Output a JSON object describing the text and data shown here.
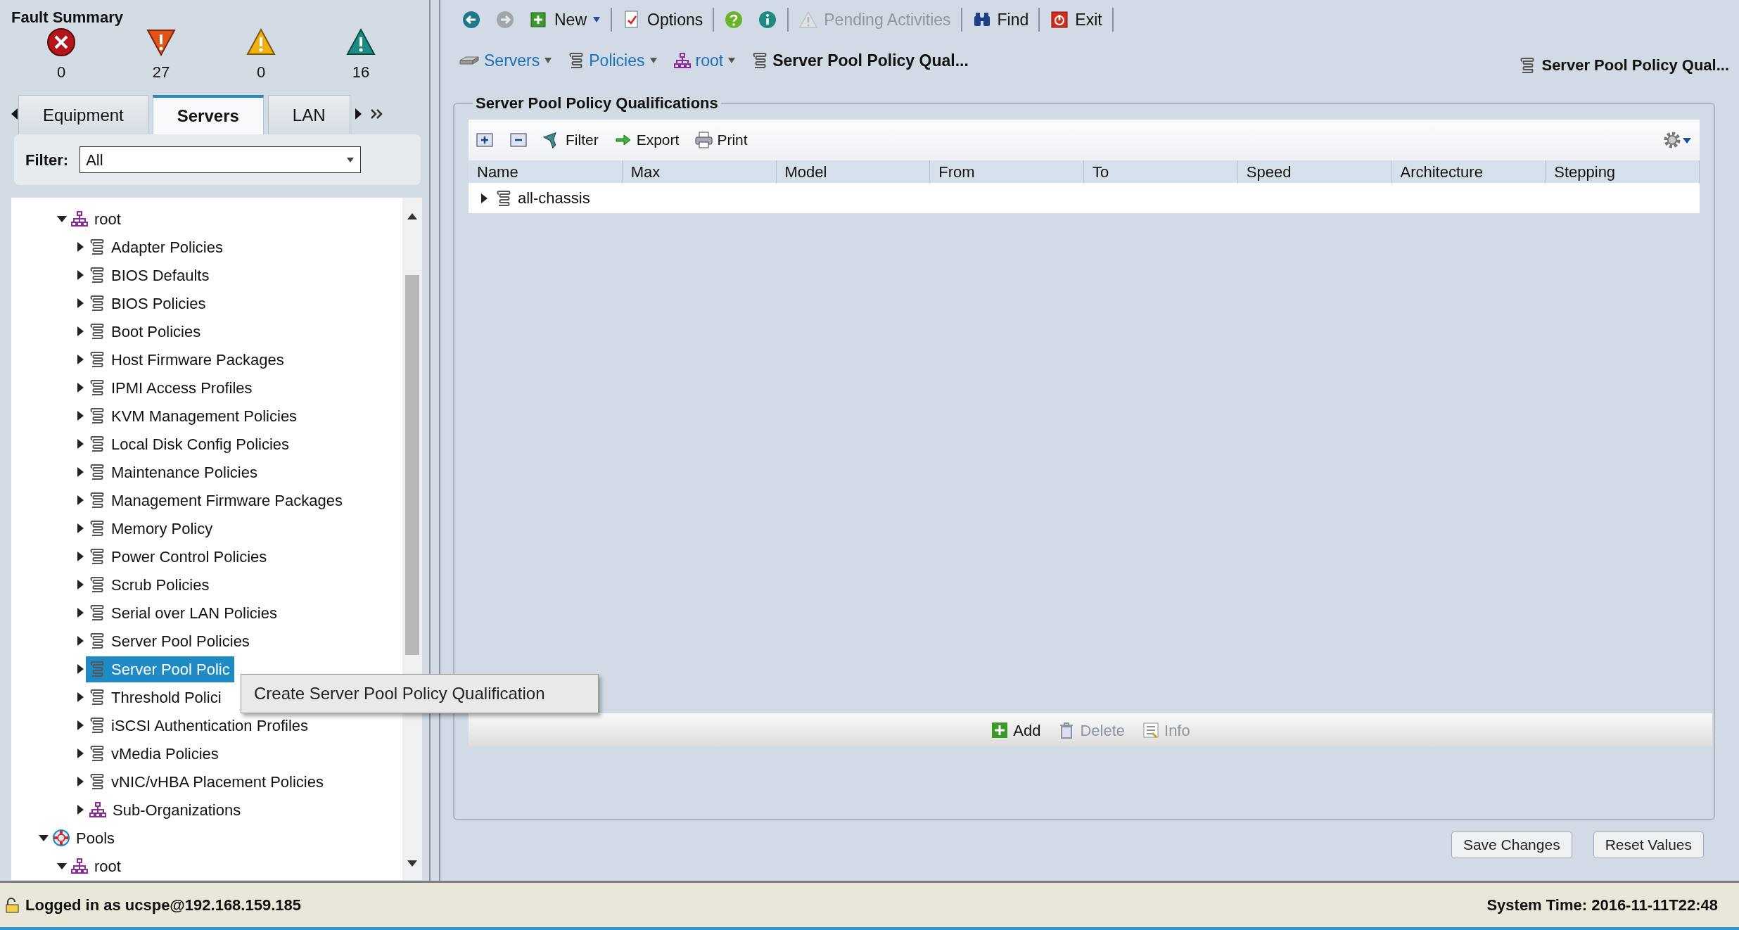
{
  "fault_summary": {
    "title": "Fault Summary",
    "counts": [
      {
        "kind": "critical",
        "count": "0"
      },
      {
        "kind": "major",
        "count": "27"
      },
      {
        "kind": "minor",
        "count": "0"
      },
      {
        "kind": "warning",
        "count": "16"
      }
    ]
  },
  "nav_tabs": [
    {
      "label": "Equipment",
      "selected": false
    },
    {
      "label": "Servers",
      "selected": true
    },
    {
      "label": "LAN",
      "selected": false
    }
  ],
  "filter": {
    "label": "Filter:",
    "value": "All"
  },
  "tree": {
    "partial_branch": [
      {
        "label": "root",
        "kind": "org",
        "expanded": true,
        "selected": false,
        "children": [
          {
            "label": "Adapter Policies",
            "kind": "policy",
            "expanded": false,
            "selected": false
          },
          {
            "label": "BIOS Defaults",
            "kind": "policy",
            "expanded": false,
            "selected": false
          },
          {
            "label": "BIOS Policies",
            "kind": "policy",
            "expanded": false,
            "selected": false
          },
          {
            "label": "Boot Policies",
            "kind": "policy",
            "expanded": false,
            "selected": false
          },
          {
            "label": "Host Firmware Packages",
            "kind": "policy",
            "expanded": false,
            "selected": false
          },
          {
            "label": "IPMI Access Profiles",
            "kind": "policy",
            "expanded": false,
            "selected": false
          },
          {
            "label": "KVM Management Policies",
            "kind": "policy",
            "expanded": false,
            "selected": false
          },
          {
            "label": "Local Disk Config Policies",
            "kind": "policy",
            "expanded": false,
            "selected": false
          },
          {
            "label": "Maintenance Policies",
            "kind": "policy",
            "expanded": false,
            "selected": false
          },
          {
            "label": "Management Firmware Packages",
            "kind": "policy",
            "expanded": false,
            "selected": false
          },
          {
            "label": "Memory Policy",
            "kind": "policy",
            "expanded": false,
            "selected": false
          },
          {
            "label": "Power Control Policies",
            "kind": "policy",
            "expanded": false,
            "selected": false
          },
          {
            "label": "Scrub Policies",
            "kind": "policy",
            "expanded": false,
            "selected": false
          },
          {
            "label": "Serial over LAN Policies",
            "kind": "policy",
            "expanded": false,
            "selected": false
          },
          {
            "label": "Server Pool Policies",
            "kind": "policy",
            "expanded": false,
            "selected": false
          },
          {
            "label": "Server Pool Polic",
            "kind": "policy",
            "expanded": false,
            "selected": true
          },
          {
            "label": "Threshold Polici",
            "kind": "policy",
            "expanded": false,
            "selected": false
          },
          {
            "label": "iSCSI Authentication Profiles",
            "kind": "policy",
            "expanded": false,
            "selected": false
          },
          {
            "label": "vMedia Policies",
            "kind": "policy",
            "expanded": false,
            "selected": false
          },
          {
            "label": "vNIC/vHBA Placement Policies",
            "kind": "policy",
            "expanded": false,
            "selected": false
          },
          {
            "label": "Sub-Organizations",
            "kind": "org",
            "expanded": false,
            "selected": false
          }
        ]
      }
    ],
    "items": [
      {
        "label": "Pools",
        "kind": "pool",
        "expanded": true,
        "selected": false,
        "children": [
          {
            "label": "root",
            "kind": "org",
            "expanded": true,
            "selected": false
          }
        ]
      }
    ]
  },
  "context_menu": {
    "items": [
      "Create Server Pool Policy Qualification"
    ]
  },
  "toolbar": [
    {
      "kind": "back",
      "disabled": false
    },
    {
      "kind": "forward",
      "disabled": true
    },
    {
      "kind": "new",
      "label": "New",
      "disabled": false
    },
    {
      "kind": "options",
      "label": "Options",
      "disabled": false
    },
    {
      "kind": "help",
      "disabled": false
    },
    {
      "kind": "info",
      "disabled": false
    },
    {
      "kind": "pending",
      "label": "Pending Activities",
      "disabled": true
    },
    {
      "kind": "find",
      "label": "Find",
      "disabled": false
    },
    {
      "kind": "exit",
      "label": "Exit",
      "disabled": false
    }
  ],
  "breadcrumb": [
    {
      "kind": "servers",
      "label": "Servers"
    },
    {
      "kind": "policy",
      "label": "Policies"
    },
    {
      "kind": "org",
      "label": "root"
    },
    {
      "kind": "current",
      "label": "Server Pool Policy Qual..."
    }
  ],
  "current_title": "Server Pool Policy Qual...",
  "panel": {
    "title": "Server Pool Policy Qualifications",
    "table_toolbar": [
      {
        "kind": "expand"
      },
      {
        "kind": "collapse"
      },
      {
        "kind": "filter",
        "label": "Filter"
      },
      {
        "kind": "export",
        "label": "Export"
      },
      {
        "kind": "print",
        "label": "Print"
      }
    ],
    "columns": [
      "Name",
      "Max",
      "Model",
      "From",
      "To",
      "Speed",
      "Architecture",
      "Stepping"
    ],
    "rows": [
      {
        "name": "all-chassis",
        "expanded": false
      }
    ],
    "actions": [
      {
        "kind": "add",
        "label": "Add",
        "disabled": false
      },
      {
        "kind": "delete",
        "label": "Delete",
        "disabled": true
      },
      {
        "kind": "info",
        "label": "Info",
        "disabled": true
      }
    ]
  },
  "buttons": [
    "Save Changes",
    "Reset Values"
  ],
  "status_bar": {
    "login": "Logged in as ucspe@192.168.159.185",
    "time": "System Time: 2016-11-11T22:48"
  }
}
